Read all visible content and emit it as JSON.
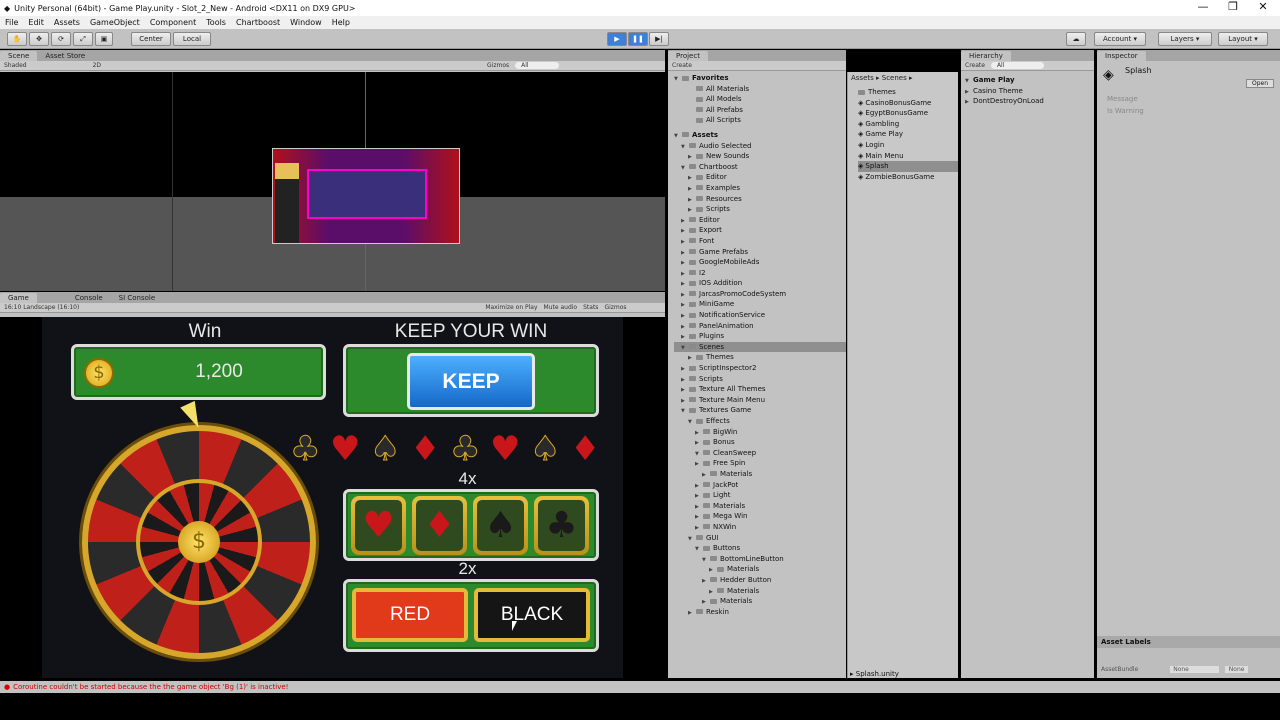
{
  "window": {
    "title": "Unity Personal (64bit) - Game Play.unity - Slot_2_New - Android <DX11 on DX9 GPU>",
    "min": "—",
    "max": "❐",
    "close": "✕"
  },
  "menu": [
    "File",
    "Edit",
    "Assets",
    "GameObject",
    "Component",
    "Tools",
    "Chartboost",
    "Window",
    "Help"
  ],
  "toolbar": {
    "center": "Center",
    "local": "Local",
    "account": "Account",
    "layers": "Layers",
    "layout": "Layout"
  },
  "scene": {
    "tab": "Scene",
    "tab2": "Asset Store",
    "shaded": "Shaded",
    "mode2d": "2D",
    "gizmos": "Gizmos",
    "search": "All"
  },
  "game": {
    "tab": "Game",
    "console_tab": "Console",
    "console_tab2": "SI Console",
    "aspect": "16:10 Landscape (16:10)",
    "maximize": "Maximize on Play",
    "mute": "Mute audio",
    "stats": "Stats",
    "gizmos": "Gizmos"
  },
  "gameplay": {
    "win_label": "Win",
    "win_amount": "1,200",
    "keep_title": "KEEP YOUR WIN",
    "keep_button": "KEEP",
    "mult4": "4x",
    "mult2": "2x",
    "red_button": "RED",
    "black_button": "BLACK",
    "wheel_center": "$"
  },
  "project": {
    "tab": "Project",
    "create": "Create",
    "favorites": [
      "Favorites",
      "All Materials",
      "All Models",
      "All Prefabs",
      "All Scripts"
    ],
    "assets": [
      "Assets",
      "Audio Selected",
      "New Sounds",
      "Chartboost",
      "Editor",
      "Examples",
      "Resources",
      "Scripts",
      "Editor",
      "Export",
      "Font",
      "Game Prefabs",
      "GoogleMobileAds",
      "I2",
      "IOS Addition",
      "JarcasPromoCodeSystem",
      "MiniGame",
      "NotificationService",
      "PanelAnimation",
      "Plugins",
      "Scenes",
      "Themes",
      "ScriptInspector2",
      "Scripts",
      "Texture All Themes",
      "Texture Main Menu",
      "Textures Game",
      "Effects",
      "BigWin",
      "Bonus",
      "CleanSweep",
      "Free Spin",
      "Materials",
      "JackPot",
      "Light",
      "Materials",
      "Mega Win",
      "NXWin",
      "GUI",
      "Buttons",
      "BottomLineButton",
      "Materials",
      "Hedder Button",
      "Materials",
      "Materials",
      "Reskin"
    ],
    "breadcrumb": "Assets ▸ Scenes ▸",
    "scenes": [
      "Themes",
      "CasinoBonusGame",
      "EgyptBonusGame",
      "Gambling",
      "Game Play",
      "Login",
      "Main Menu",
      "Splash",
      "ZombieBonusGame"
    ],
    "footer": "Splash.unity"
  },
  "hierarchy": {
    "tab": "Hierarchy",
    "create": "Create",
    "search": "All",
    "items": [
      "Game Play",
      "Casino Theme",
      "DontDestroyOnLoad"
    ]
  },
  "inspector": {
    "tab": "Inspector",
    "object": "Splash",
    "open": "Open",
    "fields": [
      "Message",
      "Is Warning"
    ],
    "asset_labels": "Asset Labels",
    "assetbundle": "AssetBundle",
    "none1": "None",
    "none2": "None"
  },
  "status": {
    "error": "Coroutine couldn't be started because the the game object 'Bg (1)' is inactive!"
  },
  "colors": {
    "green": "#2d8a2c",
    "blue_button": "#1e88e5",
    "red_button": "#e03a1a",
    "gold": "#e5b93a"
  }
}
